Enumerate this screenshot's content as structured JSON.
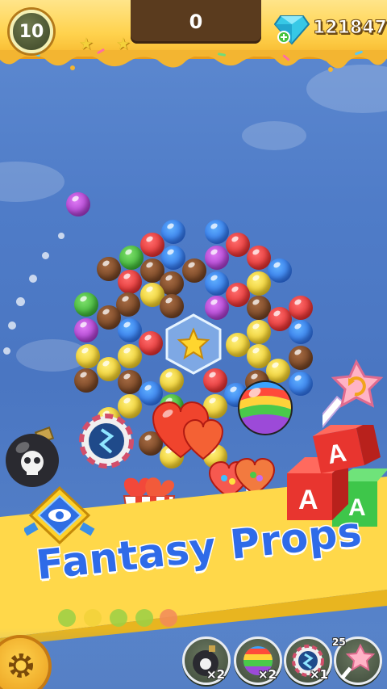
{
  "hud": {
    "level": "10",
    "score": "0",
    "gems": "121847",
    "stars_earned": 2
  },
  "banner": {
    "title": "Fantasy Props"
  },
  "props": [
    {
      "name": "bomb",
      "count": "×2"
    },
    {
      "name": "rainbow-ball",
      "count": "×2"
    },
    {
      "name": "lightning-ball",
      "count": "×1"
    },
    {
      "name": "swap-lollipop",
      "count": "25"
    }
  ],
  "blocks_letter": "A",
  "colors": {
    "blue": "#1a55d8",
    "red": "#cf1414",
    "green": "#1e9a1e",
    "yellow": "#e0b400",
    "brown": "#5a2f13",
    "purple": "#8a1fb3",
    "title_blue": "#2f6be8",
    "band_yellow": "#ffd24d"
  }
}
